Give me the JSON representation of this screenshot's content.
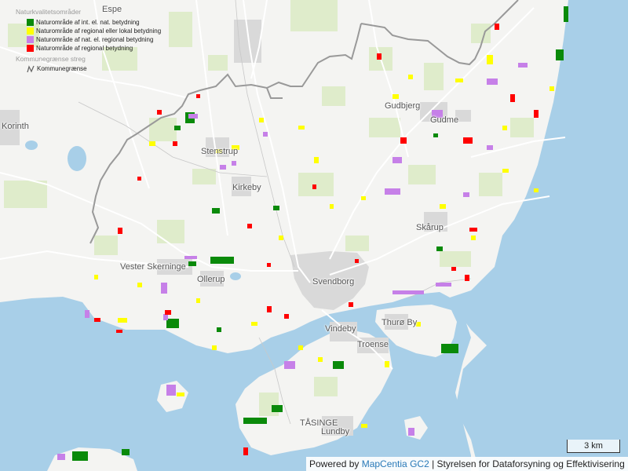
{
  "legend": {
    "group_title": "Naturkvalitetsområder",
    "items": [
      {
        "label": "Naturområde af int. el. nat. betydning",
        "color": "#0a8a0a"
      },
      {
        "label": "Naturområde af regional eller lokal betydning",
        "color": "#ffff00"
      },
      {
        "label": "Naturområde af nat. el. regional betydning",
        "color": "#c680e8"
      },
      {
        "label": "Naturområde af regional betydning",
        "color": "#ff0000"
      }
    ],
    "boundary_group_title": "Kommunegrænse streg",
    "boundary_label": "Kommunegrænse"
  },
  "places": {
    "espe": "Espe",
    "korinth": "Korinth",
    "gudbjerg": "Gudbjerg",
    "gudme": "Gudme",
    "stenstrup": "Stenstrup",
    "kirkeby": "Kirkeby",
    "skarup": "Skårup",
    "vester_skerninge": "Vester Skerninge",
    "ollerup": "Ollerup",
    "svendborg": "Svendborg",
    "thuro_by": "Thurø By",
    "vindeby": "Vindeby",
    "troense": "Troense",
    "tasinge": "TÅSINGE",
    "lundby": "Lundby"
  },
  "scale": {
    "label": "3 km"
  },
  "attribution": {
    "prefix": "Powered by ",
    "link": "MapCentia GC2",
    "suffix": " | Styrelsen for Dataforsyning og Effektivisering"
  },
  "colors": {
    "land": "#f4f4f2",
    "water": "#a8cfe8",
    "forest": "#dfeccb",
    "urban": "#d9d9d9",
    "road": "#ffffff",
    "boundary": "#999999"
  }
}
